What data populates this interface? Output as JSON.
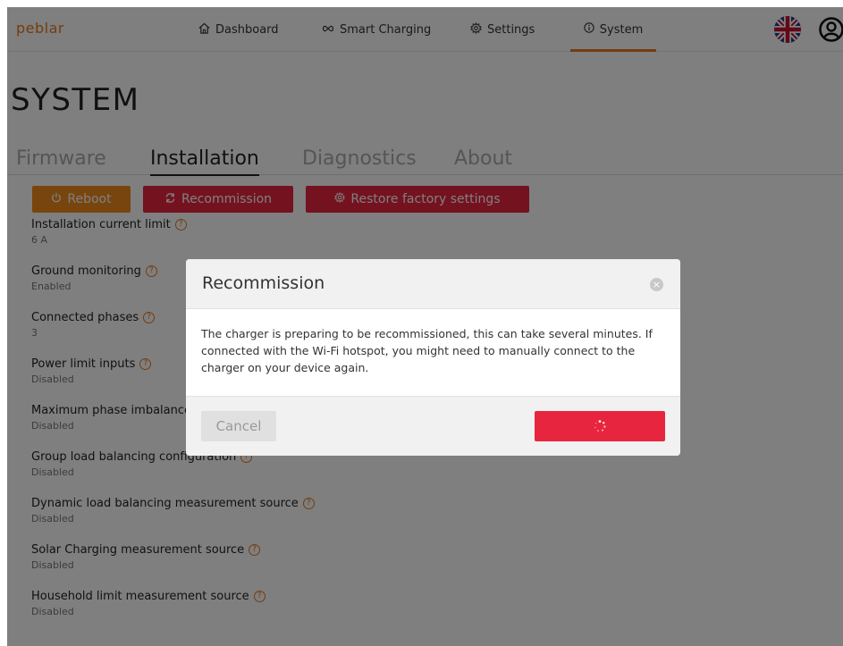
{
  "app": {
    "logo": "peblar"
  },
  "nav": {
    "items": [
      {
        "label": "Dashboard",
        "icon": "home-icon"
      },
      {
        "label": "Smart Charging",
        "icon": "infinity-icon"
      },
      {
        "label": "Settings",
        "icon": "gear-icon"
      },
      {
        "label": "System",
        "icon": "info-icon",
        "active": true
      }
    ],
    "language_icon": "uk-flag-icon",
    "user_icon": "user-icon"
  },
  "page": {
    "title": "SYSTEM",
    "tabs": [
      {
        "label": "Firmware"
      },
      {
        "label": "Installation",
        "active": true
      },
      {
        "label": "Diagnostics"
      },
      {
        "label": "About"
      }
    ],
    "actions": {
      "reboot": "Reboot",
      "recommission": "Recommission",
      "restore": "Restore factory settings"
    },
    "settings": [
      {
        "label": "Installation current limit",
        "value": "6 A"
      },
      {
        "label": "Ground monitoring",
        "value": "Enabled"
      },
      {
        "label": "Connected phases",
        "value": "3"
      },
      {
        "label": "Power limit inputs",
        "value": "Disabled"
      },
      {
        "label": "Maximum phase imbalance",
        "value": "Disabled"
      },
      {
        "label": "Group load balancing configuration",
        "value": "Disabled"
      },
      {
        "label": "Dynamic load balancing measurement source",
        "value": "Disabled"
      },
      {
        "label": "Solar Charging measurement source",
        "value": "Disabled"
      },
      {
        "label": "Household limit measurement source",
        "value": "Disabled"
      }
    ]
  },
  "modal": {
    "title": "Recommission",
    "body": "The charger is preparing to be recommissioned, this can take several minutes. If connected with the Wi-Fi hotspot, you might need to manually connect to the charger on your device again.",
    "cancel": "Cancel",
    "confirm_state": "loading"
  },
  "colors": {
    "accent": "#e6781e",
    "danger": "#e8253f",
    "overlay": "rgba(0,0,0,0.5)"
  }
}
